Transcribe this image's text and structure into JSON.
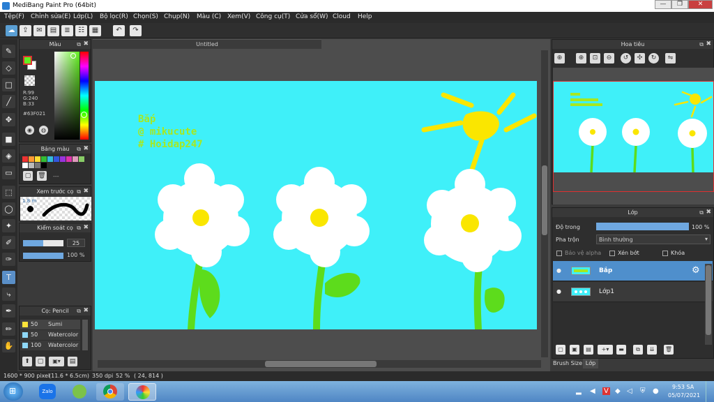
{
  "window": {
    "title": "MediBang Paint Pro (64bit)",
    "controls": [
      "—",
      "❐",
      "✕"
    ]
  },
  "menu": [
    "Tệp(F)",
    "Chỉnh sửa(E)",
    "Lớp(L)",
    "Bộ lọc(R)",
    "Chọn(S)",
    "Chụp(N)",
    "Màu (C)",
    "Xem(V)",
    "Công cụ(T)",
    "Cửa sổ(W)",
    "Cloud",
    "Help"
  ],
  "document": {
    "tab_title": "Untitled"
  },
  "canvas_text": {
    "line1": "Bắp",
    "line2": "@ mikucute",
    "line3": "# Hoidap247"
  },
  "color_panel": {
    "title": "Màu",
    "r": "R:99",
    "g": "G:240",
    "b": "B:33",
    "hex": "#63F021",
    "fg_color": "#63F021",
    "bg_color": "#ffffff"
  },
  "palette_panel": {
    "title": "Bảng màu",
    "dashes": "---"
  },
  "brush_preview_panel": {
    "title": "Xem trước cọ",
    "size_label": "1.8 m"
  },
  "brush_control_panel": {
    "title": "Kiểm soát cọ",
    "size_value": "25",
    "opacity_value": "100 %"
  },
  "brush_list_panel": {
    "title": "Cọ: Pencil",
    "items": [
      {
        "size": "50",
        "name": "Sumi",
        "color": "#ffe43a"
      },
      {
        "size": "50",
        "name": "Watercolor",
        "color": "#8fd8f8"
      },
      {
        "size": "100",
        "name": "Watercolor",
        "color": "#8fd8f8"
      }
    ]
  },
  "navigator_panel": {
    "title": "Hoa tiêu"
  },
  "layer_panel": {
    "title": "Lớp",
    "opacity_label": "Độ trong",
    "opacity_value": "100 %",
    "blend_label": "Pha trộn",
    "blend_value": "Bình thường",
    "protect_alpha": "Bảo vệ alpha",
    "clipping": "Xén bớt",
    "lock": "Khóa",
    "layers": [
      {
        "name": "Bắp",
        "selected": true
      },
      {
        "name": "Lớp1",
        "selected": false
      }
    ]
  },
  "bottom_tabs": [
    "Brush Size",
    "Lớp"
  ],
  "status": {
    "size": "1600 * 900 pixel",
    "physical": "(11.6 * 6.5cm)",
    "dpi": "350 dpi",
    "zoom": "52 %",
    "coords": "( 24, 814 )"
  },
  "taskbar": {
    "zalo_label": "Zalo",
    "time": "9:53 SA",
    "date": "05/07/2021"
  },
  "colors": {
    "canvas_bg": "#3ff0f9",
    "accent": "#5a9fd4",
    "sun": "#fae600",
    "stem": "#5ddc1c"
  }
}
